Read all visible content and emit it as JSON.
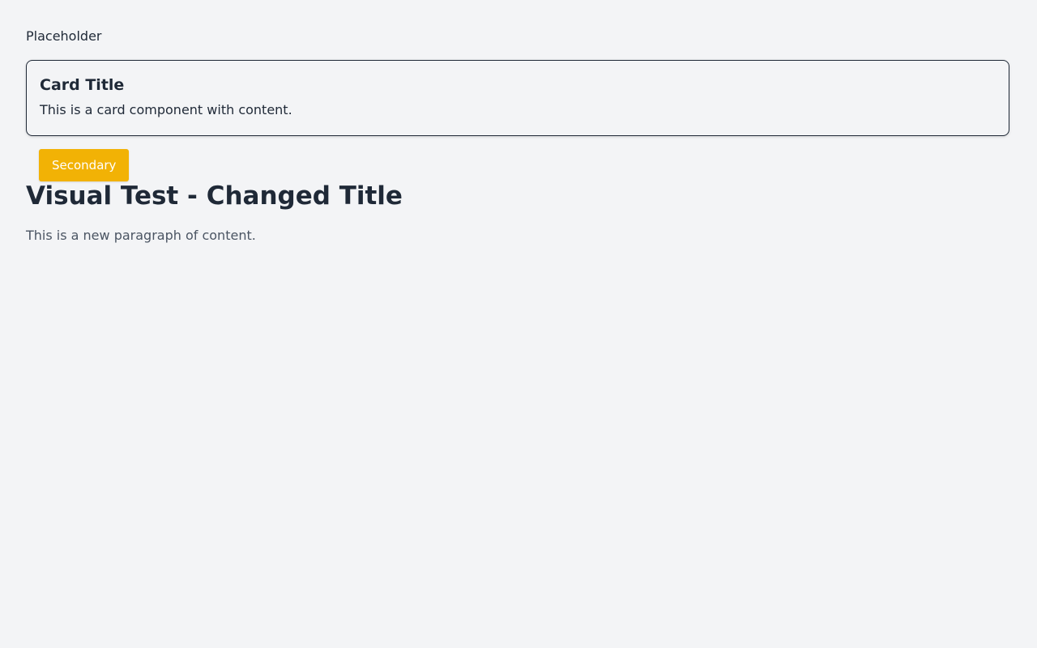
{
  "image": {
    "alt": "Placeholder"
  },
  "card": {
    "title": "Card Title",
    "text": "This is a card component with content."
  },
  "buttons": {
    "secondary_label": "Secondary"
  },
  "main": {
    "heading": "Visual Test - Changed Title",
    "paragraph": "This is a new paragraph of content."
  },
  "colors": {
    "background": "#f3f4f6",
    "text": "#1f2937",
    "muted_text": "#4b5563",
    "secondary_button": "#f2b205"
  }
}
